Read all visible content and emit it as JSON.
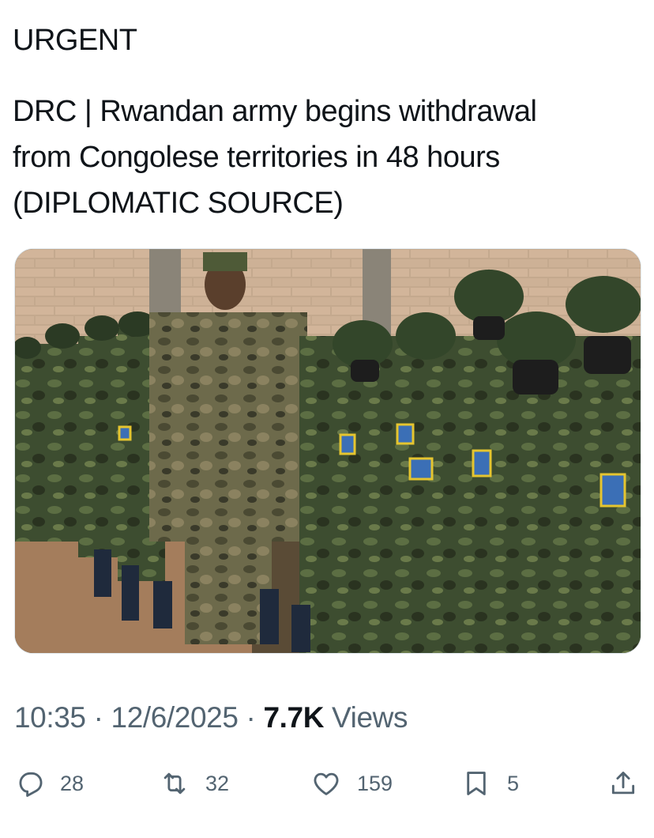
{
  "tweet": {
    "label": "URGENT",
    "body_line_1": "DRC | Rwandan army begins withdrawal",
    "body_line_2": "from Congolese territories in 48 hours",
    "body_line_3": "(DIPLOMATIC SOURCE)"
  },
  "meta": {
    "time": "10:35",
    "date": "12/6/2025",
    "views_count": "7.7K",
    "views_label": "Views"
  },
  "actions": {
    "reply_count": "28",
    "repost_count": "32",
    "like_count": "159",
    "bookmark_count": "5"
  },
  "icons": {
    "reply": "reply-icon",
    "repost": "repost-icon",
    "like": "heart-icon",
    "bookmark": "bookmark-icon",
    "share": "share-icon"
  },
  "colors": {
    "text": "#0f1419",
    "muted": "#536471"
  }
}
